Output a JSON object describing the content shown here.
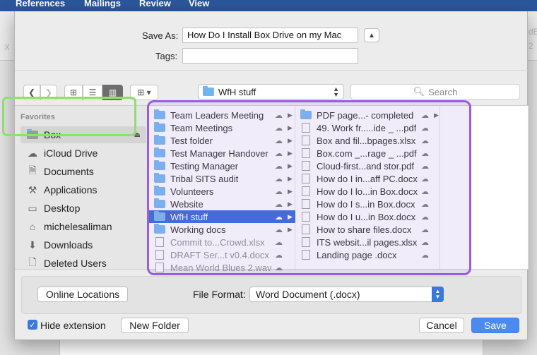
{
  "app": {
    "ribbon_tabs": [
      "References",
      "Mailings",
      "Review",
      "View"
    ],
    "bg_glyphs": [
      "X",
      "dE",
      "2"
    ]
  },
  "dialog": {
    "save_as_label": "Save As:",
    "save_as_value": "How Do I Install Box Drive on my Mac",
    "tags_label": "Tags:",
    "tags_value": "",
    "location": "WfH stuff",
    "search_placeholder": "Search"
  },
  "sidebar": {
    "heading": "Favorites",
    "items": [
      {
        "label": "Box",
        "icon": "folder-icon"
      },
      {
        "label": "iCloud Drive",
        "icon": "cloud-icon"
      },
      {
        "label": "Documents",
        "icon": "documents-icon"
      },
      {
        "label": "Applications",
        "icon": "applications-icon"
      },
      {
        "label": "Desktop",
        "icon": "desktop-icon"
      },
      {
        "label": "michelesaliman",
        "icon": "home-icon"
      },
      {
        "label": "Downloads",
        "icon": "downloads-icon"
      },
      {
        "label": "Deleted Users",
        "icon": "document-icon"
      }
    ]
  },
  "column1": [
    {
      "name": "Team Leaders Meeting",
      "type": "folder"
    },
    {
      "name": "Team Meetings",
      "type": "folder"
    },
    {
      "name": "Test folder",
      "type": "folder"
    },
    {
      "name": "Test Manager Handover",
      "type": "folder"
    },
    {
      "name": "Testing Manager",
      "type": "folder"
    },
    {
      "name": "Tribal SITS audit",
      "type": "folder"
    },
    {
      "name": "Volunteers",
      "type": "folder"
    },
    {
      "name": "Website",
      "type": "folder"
    },
    {
      "name": "WfH stuff",
      "type": "folder"
    },
    {
      "name": "Working docs",
      "type": "folder"
    },
    {
      "name": "Commit to...Crowd.xlsx",
      "type": "xlsx"
    },
    {
      "name": "DRAFT Ser...t  v0.4.docx",
      "type": "docx"
    },
    {
      "name": "Mean World Blues 2.wav",
      "type": "wav"
    }
  ],
  "column2": [
    {
      "name": "PDF page...- completed",
      "type": "folder"
    },
    {
      "name": "49. Work fr.....ide _ ...pdf",
      "type": "pdf"
    },
    {
      "name": "Box and fil...bpages.xlsx",
      "type": "xlsx"
    },
    {
      "name": "Box.com _...rage _ ...pdf",
      "type": "pdf"
    },
    {
      "name": "Cloud-first...and stor.pdf",
      "type": "pdf"
    },
    {
      "name": "How do I in...aff PC.docx",
      "type": "docx"
    },
    {
      "name": "How do I lo...in Box.docx",
      "type": "docx"
    },
    {
      "name": "How do I s...in Box.docx",
      "type": "docx"
    },
    {
      "name": "How do I u...in Box.docx",
      "type": "docx"
    },
    {
      "name": "How to share files.docx",
      "type": "docx"
    },
    {
      "name": "ITS websit...il pages.xlsx",
      "type": "xlsx"
    },
    {
      "name": "Landing page .docx",
      "type": "docx"
    }
  ],
  "bottom": {
    "online_locations": "Online Locations",
    "file_format_label": "File Format:",
    "file_format_value": "Word Document (.docx)",
    "hide_extension": "Hide extension",
    "new_folder": "New Folder",
    "cancel": "Cancel",
    "save": "Save"
  },
  "colors": {
    "selection": "#2e62d7",
    "green_highlight": "#8ee06e",
    "purple_highlight": "#9a5ce0",
    "primary_button": "#4b8bf0"
  }
}
